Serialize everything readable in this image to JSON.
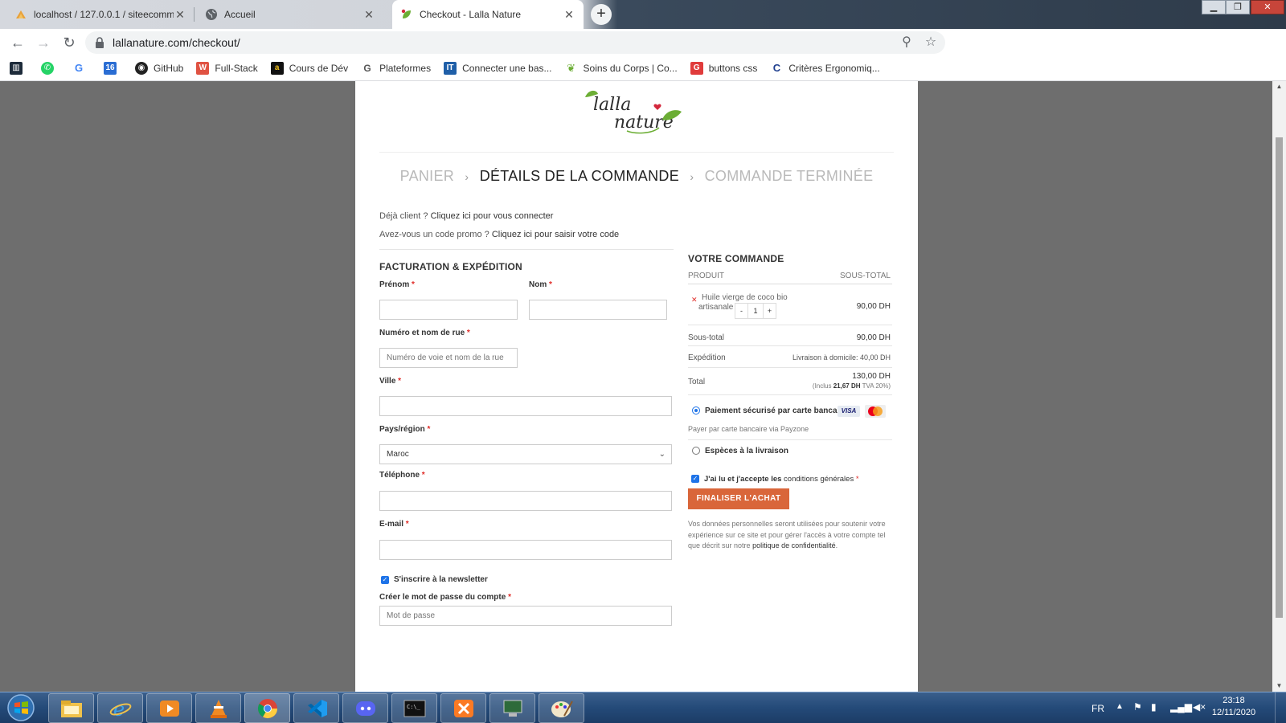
{
  "browser": {
    "tabs": [
      {
        "title": "localhost / 127.0.0.1 / siteecommerce",
        "icon": "phpmyadmin-icon"
      },
      {
        "title": "Accueil",
        "icon": "globe-icon"
      },
      {
        "title": "Checkout - Lalla Nature",
        "icon": "lalla-nature-leaf-icon"
      }
    ],
    "url": "lallanature.com/checkout/",
    "bookmarks": [
      {
        "label": "",
        "icon": "trello-icon"
      },
      {
        "label": "",
        "icon": "whatsapp-icon"
      },
      {
        "label": "",
        "icon": "google-icon"
      },
      {
        "label": "",
        "icon": "calendar-icon"
      },
      {
        "label": "GitHub",
        "icon": "github-icon"
      },
      {
        "label": "Full-Stack",
        "icon": "w3schools-icon"
      },
      {
        "label": "Cours de Dév",
        "icon": "amazon-icon"
      },
      {
        "label": "Plateformes",
        "icon": "plateformes-icon"
      },
      {
        "label": "Connecter une bas...",
        "icon": "it-icon"
      },
      {
        "label": "Soins du Corps | Co...",
        "icon": "lalla-nature-leaf-icon"
      },
      {
        "label": "buttons css",
        "icon": "g-red-icon"
      },
      {
        "label": "Critères Ergonomiq...",
        "icon": "c-blue-icon"
      }
    ]
  },
  "site": {
    "logo_alt": "lalla nature",
    "steps": [
      "PANIER",
      "DÉTAILS DE LA COMMANDE",
      "COMMANDE TERMINÉE"
    ],
    "notices": {
      "login_prefix": "Déjà client ?",
      "login_link": "Cliquez ici pour vous connecter",
      "promo_prefix": "Avez-vous un code promo ?",
      "promo_link": "Cliquez ici pour saisir votre code"
    },
    "billing": {
      "title": "FACTURATION & EXPÉDITION",
      "first_name_label": "Prénom",
      "last_name_label": "Nom",
      "street_label": "Numéro et nom de rue",
      "street_placeholder": "Numéro de voie et nom de la rue",
      "city_label": "Ville",
      "country_label": "Pays/région",
      "country_value": "Maroc",
      "phone_label": "Téléphone",
      "email_label": "E-mail",
      "newsletter_label": "S'inscrire à la newsletter",
      "newsletter_checked": true,
      "password_label": "Créer le mot de passe du compte",
      "password_placeholder": "Mot de passe",
      "required_mark": "*"
    },
    "order": {
      "title": "VOTRE COMMANDE",
      "col_product": "PRODUIT",
      "col_subtotal": "SOUS-TOTAL",
      "items": [
        {
          "name_line1": "Huile vierge de coco bio",
          "name_line2": "artisanale",
          "qty": "1",
          "price": "90,00 DH"
        }
      ],
      "subtotal_label": "Sous-total",
      "subtotal_value": "90,00 DH",
      "shipping_label": "Expédition",
      "shipping_value": "Livraison à domicile: 40,00 DH",
      "total_label": "Total",
      "total_value": "130,00 DH",
      "tax_prefix": "(Inclus",
      "tax_amount": "21,67 DH",
      "tax_suffix": "TVA 20%)",
      "payment_card_label": "Paiement sécurisé par carte bancaire",
      "payment_card_desc": "Payer par carte bancaire via Payzone",
      "payment_cash_label": "Espèces à la livraison",
      "payment_selected": "card",
      "terms_prefix": "J'ai lu et j'accepte les",
      "terms_link": "conditions générales",
      "terms_mark": "*",
      "buy_button": "FINALISER L'ACHAT",
      "privacy_text": "Vos données personnelles seront utilisées pour soutenir votre expérience sur ce site et pour gérer l'accès à votre compte tel que décrit sur notre",
      "privacy_link": "politique de confidentialité",
      "privacy_end": ".",
      "card_visa": "VISA",
      "card_mastercard": "mastercard"
    }
  },
  "taskbar": {
    "apps": [
      "explorer-icon",
      "internet-explorer-icon",
      "media-player-icon",
      "vlc-icon",
      "chrome-icon",
      "vscode-icon",
      "discord-icon",
      "cmd-icon",
      "xampp-icon",
      "device-manager-icon",
      "paint-icon"
    ],
    "language": "FR",
    "time": "23:18",
    "date": "12/11/2020"
  },
  "colors": {
    "accent_button": "#d9663a",
    "checkbox_blue": "#1e73e8",
    "required_red": "#e02b27",
    "page_bg_overlay": "#6e6e6e"
  }
}
